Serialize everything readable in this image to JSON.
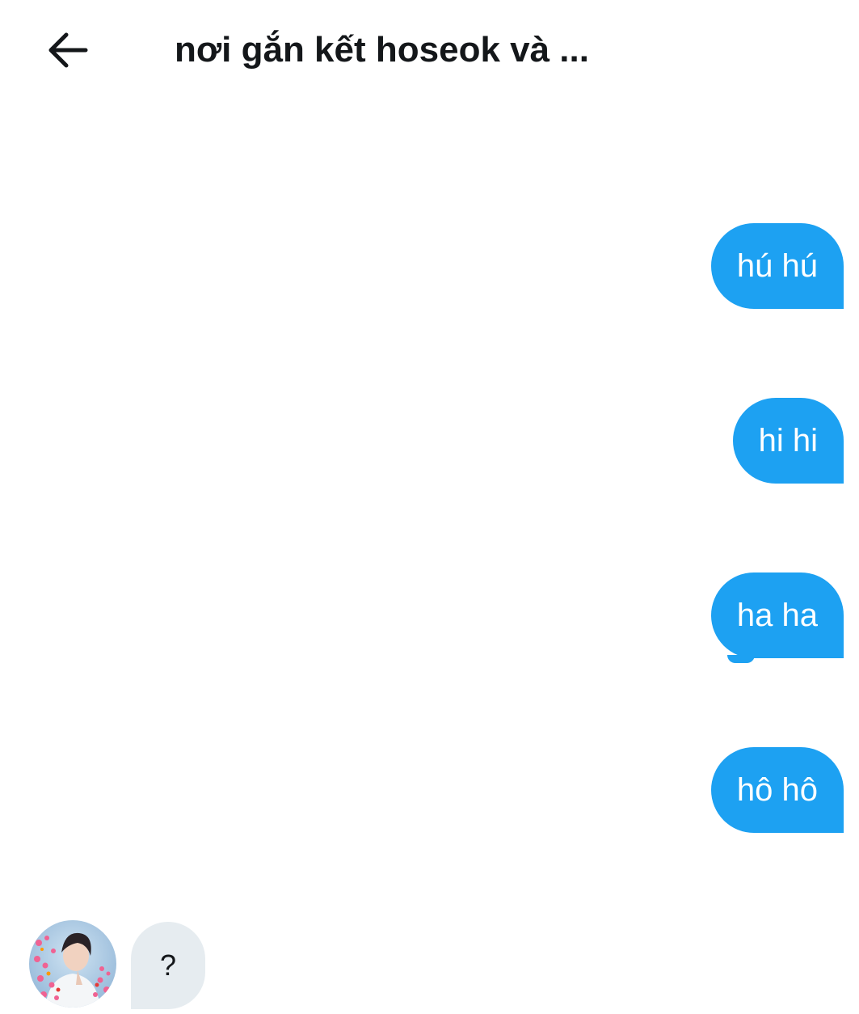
{
  "header": {
    "title": "nơi gắn kết hoseok và ..."
  },
  "messages": {
    "outgoing": [
      {
        "text": "hú hú"
      },
      {
        "text": "hi hi"
      },
      {
        "text": "ha ha"
      },
      {
        "text": "hô hô"
      }
    ],
    "incoming": [
      {
        "text": "?"
      }
    ]
  },
  "icons": {
    "back": "arrow-left-icon",
    "avatar": "user-avatar"
  },
  "colors": {
    "outgoing_bubble": "#1da1f2",
    "incoming_bubble": "#e6ecf0",
    "text": "#14171a"
  }
}
